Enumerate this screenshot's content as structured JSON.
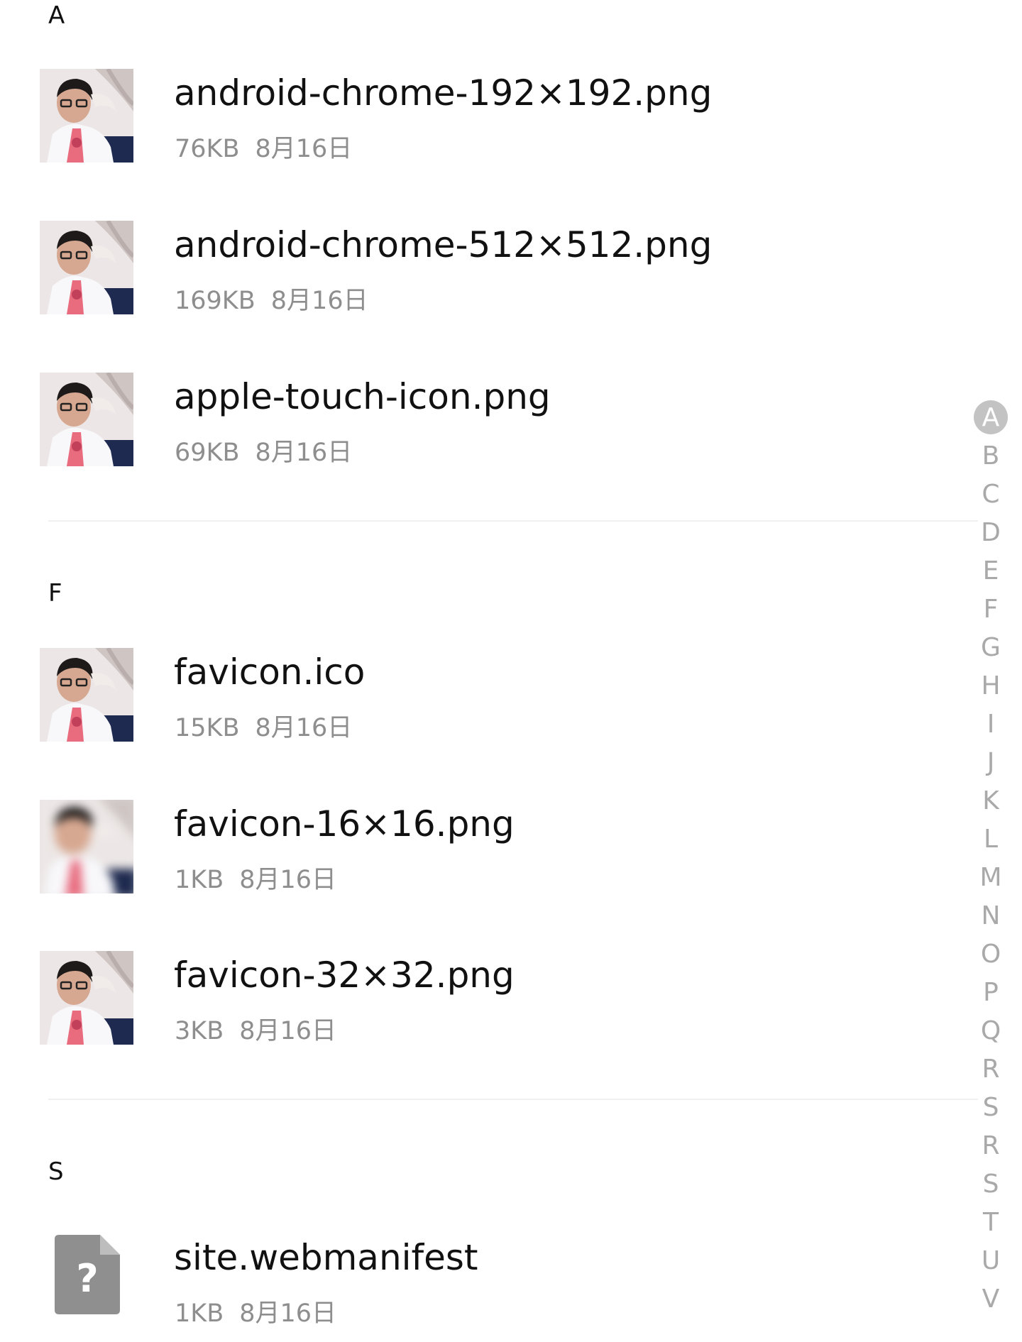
{
  "sections": [
    {
      "letter": "A",
      "files": [
        {
          "name": "android-chrome-192×192.png",
          "size": "76KB",
          "date": "8月16日",
          "thumbnail": "portrait-photo"
        },
        {
          "name": "android-chrome-512×512.png",
          "size": "169KB",
          "date": "8月16日",
          "thumbnail": "portrait-photo"
        },
        {
          "name": "apple-touch-icon.png",
          "size": "69KB",
          "date": "8月16日",
          "thumbnail": "portrait-photo"
        }
      ]
    },
    {
      "letter": "F",
      "files": [
        {
          "name": "favicon.ico",
          "size": "15KB",
          "date": "8月16日",
          "thumbnail": "portrait-photo"
        },
        {
          "name": "favicon-16×16.png",
          "size": "1KB",
          "date": "8月16日",
          "thumbnail": "portrait-photo-blurred"
        },
        {
          "name": "favicon-32×32.png",
          "size": "3KB",
          "date": "8月16日",
          "thumbnail": "portrait-photo"
        }
      ]
    },
    {
      "letter": "S",
      "files": [
        {
          "name": "site.webmanifest",
          "size": "1KB",
          "date": "8月16日",
          "thumbnail": "unknown-file-icon"
        }
      ]
    }
  ],
  "index_bar": {
    "active": "A",
    "letters": [
      "A",
      "B",
      "C",
      "D",
      "E",
      "F",
      "G",
      "H",
      "I",
      "J",
      "K",
      "L",
      "M",
      "N",
      "O",
      "P",
      "Q",
      "R",
      "S",
      "R",
      "S",
      "T",
      "U",
      "V"
    ]
  },
  "colors": {
    "background": "#ffffff",
    "primary_text": "#111111",
    "secondary_text": "#8e8e8e",
    "index_text": "#a9a9a9",
    "index_active_bg": "#c3c3c3",
    "divider": "#f0f0f0"
  }
}
